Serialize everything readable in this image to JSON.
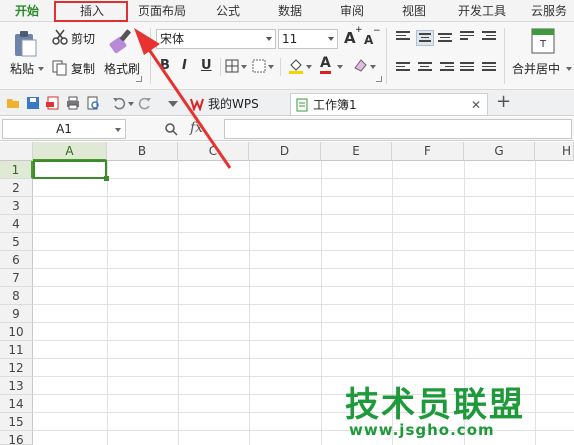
{
  "menu": {
    "tabs": [
      "开始",
      "插入",
      "页面布局",
      "公式",
      "数据",
      "审阅",
      "视图",
      "开发工具",
      "云服务"
    ],
    "active_tab": "开始",
    "highlighted_tab": "插入"
  },
  "ribbon": {
    "paste_label": "粘贴",
    "cut_label": "剪切",
    "copy_label": "复制",
    "format_painter_label": "格式刷",
    "font_name": "宋体",
    "font_size": "11",
    "bold": "B",
    "italic": "I",
    "underline": "U",
    "font_color_letter": "A",
    "grow_font": "A",
    "shrink_font": "A",
    "merge_center_label": "合并居中"
  },
  "doc_tabs": {
    "home_tab": "我的WPS",
    "workbook_tab": "工作簿1",
    "new_tab": "+"
  },
  "formula_bar": {
    "name_box": "A1",
    "fx_label": "fx"
  },
  "grid": {
    "columns": [
      "A",
      "B",
      "C",
      "D",
      "E",
      "F",
      "G",
      "H"
    ],
    "rows": [
      "1",
      "2",
      "3",
      "4",
      "5",
      "6",
      "7",
      "8",
      "9",
      "10",
      "11",
      "12",
      "13",
      "14",
      "15",
      "16"
    ],
    "selected_column": "A",
    "selected_row": "1"
  },
  "watermark": {
    "title": "技术员联盟",
    "url": "www.jsgho.com"
  },
  "colors": {
    "accent_green": "#2b8a2b",
    "highlight_red": "#e03030",
    "arrow_red": "#e8322f",
    "watermark_green": "#1e9a3a"
  }
}
